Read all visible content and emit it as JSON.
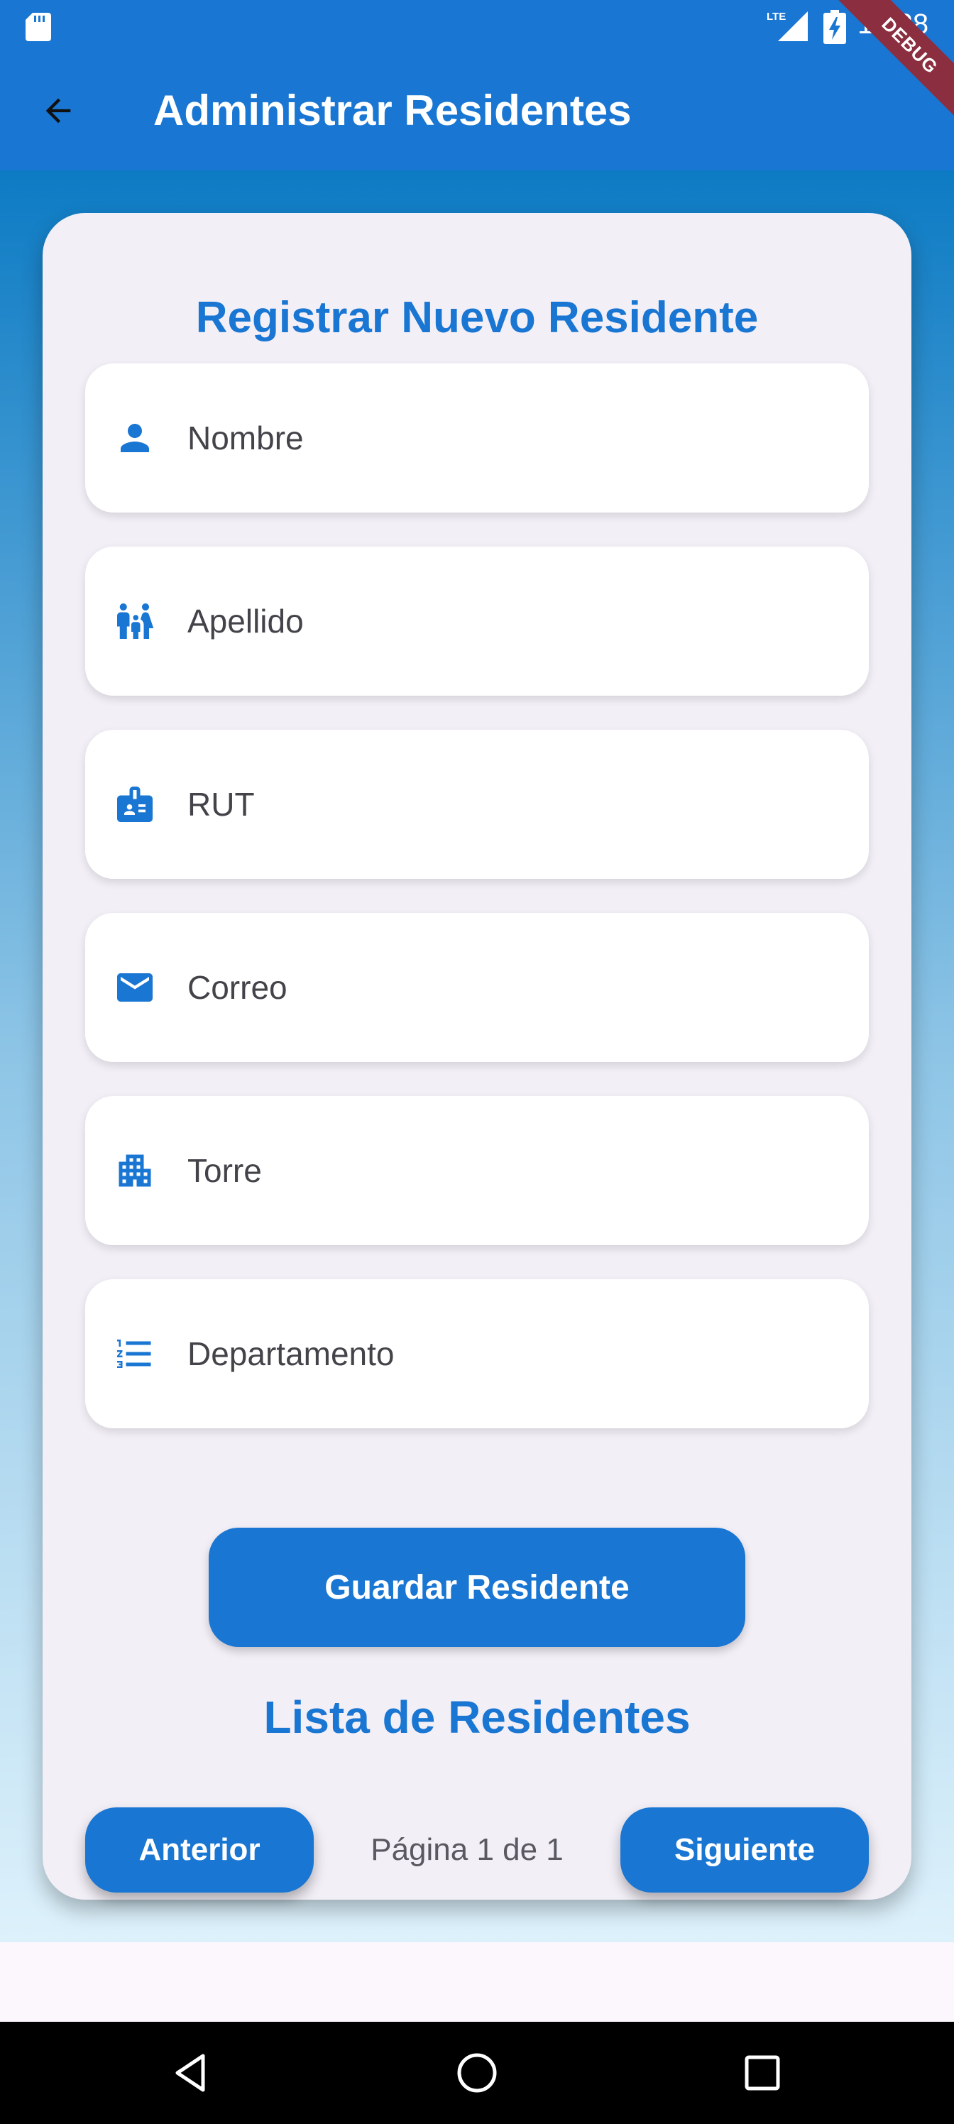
{
  "status_bar": {
    "time": "12:28",
    "network_label": "LTE",
    "icons": [
      "sd-card-icon",
      "signal-icon",
      "battery-charging-icon"
    ],
    "debug_banner": "DEBUG"
  },
  "app_bar": {
    "title": "Administrar Residentes",
    "back_icon": "arrow-back-icon",
    "color": "#1976d2"
  },
  "form": {
    "title": "Registrar Nuevo Residente",
    "fields": [
      {
        "placeholder": "Nombre",
        "icon": "person-icon"
      },
      {
        "placeholder": "Apellido",
        "icon": "family-icon"
      },
      {
        "placeholder": "RUT",
        "icon": "badge-icon"
      },
      {
        "placeholder": "Correo",
        "icon": "email-icon"
      },
      {
        "placeholder": "Torre",
        "icon": "apartment-icon"
      },
      {
        "placeholder": "Departamento",
        "icon": "numbered-list-icon"
      }
    ],
    "save_label": "Guardar Residente"
  },
  "list": {
    "title": "Lista de Residentes",
    "prev_label": "Anterior",
    "next_label": "Siguiente",
    "page_text": "Página 1 de 1"
  },
  "nav_bar": {
    "icons": [
      "triangle-back-icon",
      "circle-home-icon",
      "square-recents-icon"
    ]
  },
  "colors": {
    "primary": "#1976d2",
    "card_background": "#f3eff7",
    "gradient_top": "#0d7bc4",
    "gradient_bottom": "#ddf1fb"
  }
}
